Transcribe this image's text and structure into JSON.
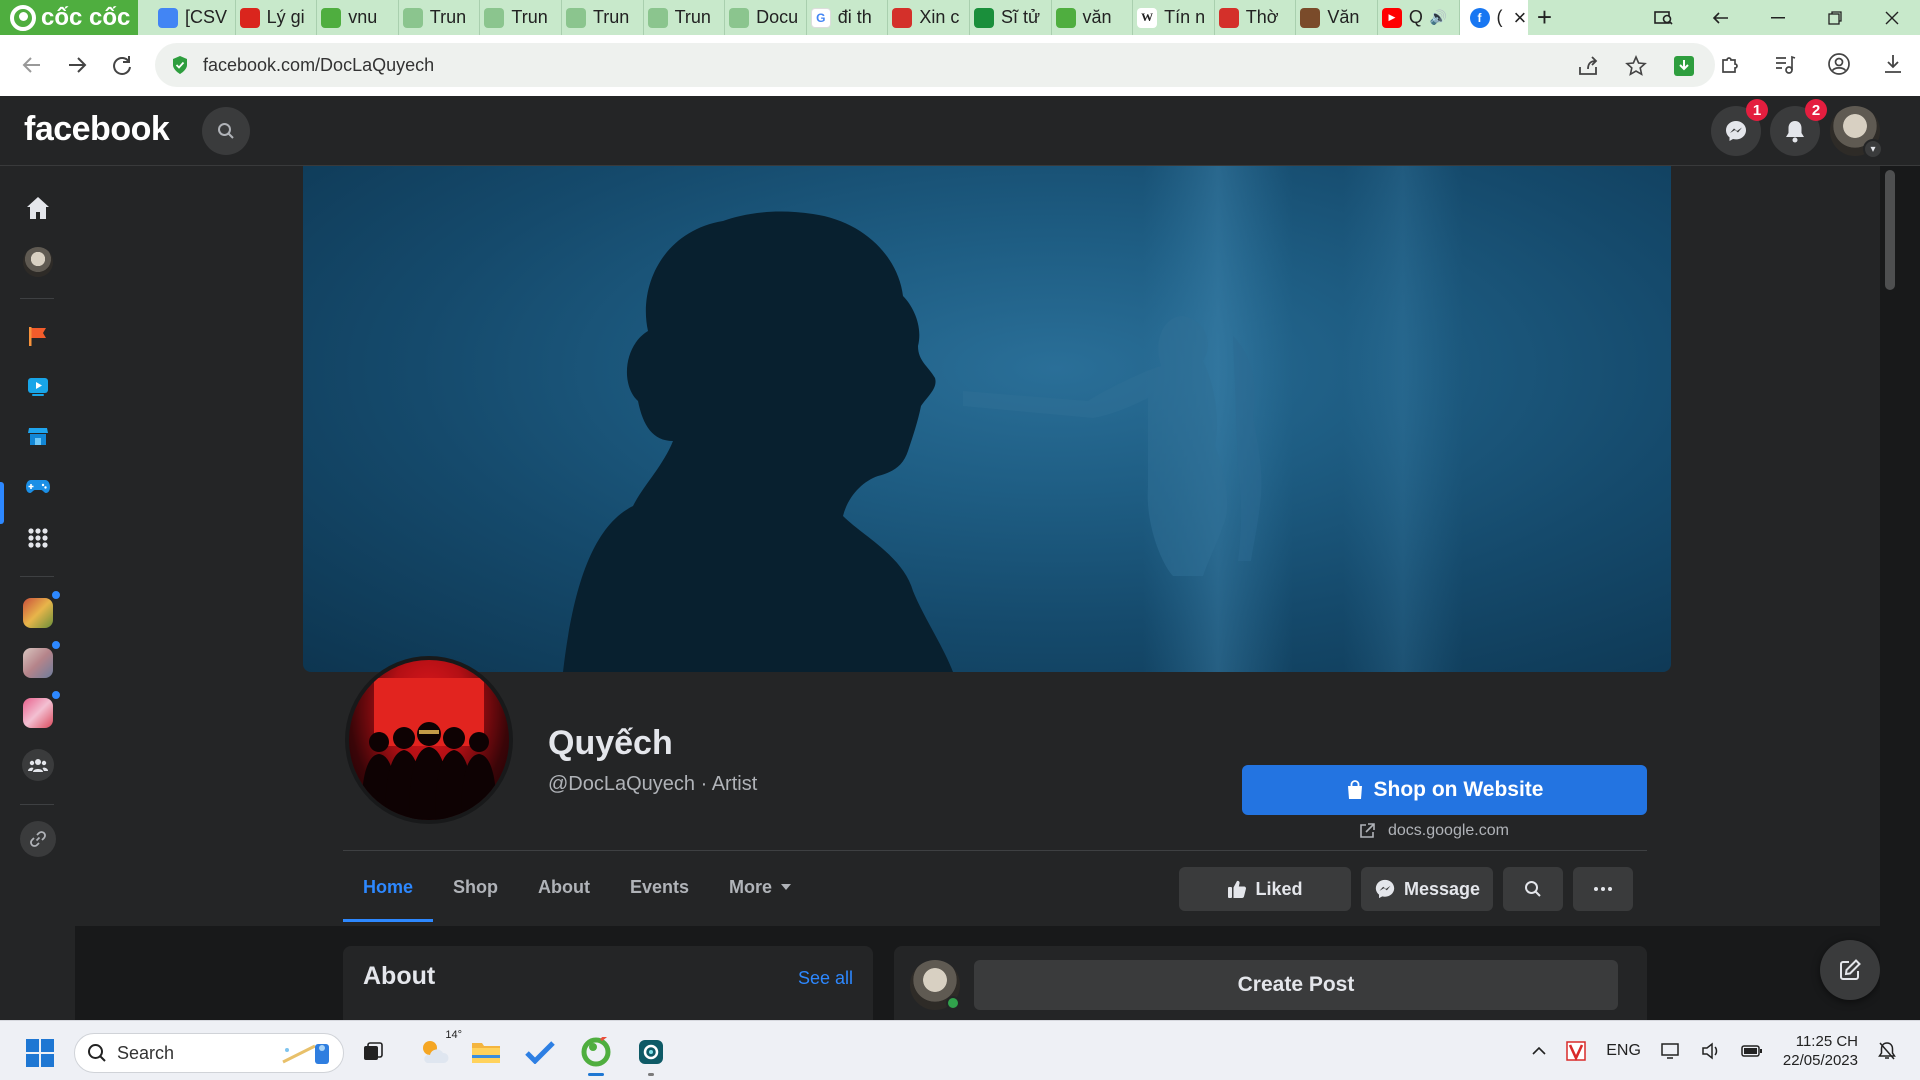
{
  "browser": {
    "brand_name": "cốc cốc",
    "tabs": [
      {
        "title": "[CSV",
        "icon": "google-docs-icon",
        "color": "#4285f4"
      },
      {
        "title": "Lý gi",
        "icon": "star-flag-icon",
        "color": "#da251d"
      },
      {
        "title": "vnu",
        "icon": "coccoc-icon",
        "color": "#4fae3f"
      },
      {
        "title": "Trun",
        "icon": "globe-icon",
        "color": "#8bc58e"
      },
      {
        "title": "Trun",
        "icon": "globe-icon",
        "color": "#8bc58e"
      },
      {
        "title": "Trun",
        "icon": "globe-icon",
        "color": "#8bc58e"
      },
      {
        "title": "Trun",
        "icon": "globe-icon",
        "color": "#8bc58e"
      },
      {
        "title": "Docu",
        "icon": "globe-icon",
        "color": "#8bc58e"
      },
      {
        "title": "đi th",
        "icon": "google-icon",
        "color": "#ffffff"
      },
      {
        "title": "Xin c",
        "icon": "emblem-icon",
        "color": "#d4302a"
      },
      {
        "title": "Sĩ tử",
        "icon": "news-icon",
        "color": "#1a8f3b"
      },
      {
        "title": "văn",
        "icon": "coccoc-icon",
        "color": "#4fae3f"
      },
      {
        "title": "Tín n",
        "icon": "wikipedia-icon",
        "color": "#ffffff"
      },
      {
        "title": "Thờ",
        "icon": "emblem-icon",
        "color": "#d4302a"
      },
      {
        "title": "Văn",
        "icon": "figure-icon",
        "color": "#7a4b2a"
      },
      {
        "title": "Q",
        "icon": "youtube-icon",
        "color": "#ff0000"
      }
    ],
    "active_tab": {
      "title": "(",
      "icon": "facebook-icon",
      "color": "#1877f2"
    },
    "url": "facebook.com/DocLaQuyech"
  },
  "facebook": {
    "logo": "facebook",
    "messenger_badge": "1",
    "notifications_badge": "2",
    "page": {
      "name": "Quyếch",
      "handle_line": "@DocLaQuyech · Artist",
      "primary_button": "Shop on Website",
      "website": "docs.google.com",
      "tabs": [
        {
          "label": "Home",
          "active": true
        },
        {
          "label": "Shop",
          "active": false
        },
        {
          "label": "About",
          "active": false
        },
        {
          "label": "Events",
          "active": false
        },
        {
          "label": "More",
          "active": false
        }
      ],
      "liked_button": "Liked",
      "message_button": "Message"
    },
    "about": {
      "title": "About",
      "see_all": "See all"
    },
    "create_post": "Create Post"
  },
  "taskbar": {
    "search_placeholder": "Search",
    "weather": "14°",
    "language": "ENG",
    "time": "11:25 CH",
    "date": "22/05/2023"
  },
  "colors": {
    "fb_blue": "#2374e1",
    "fb_dark": "#242526",
    "fb_bg": "#18191a",
    "coccoc_green": "#4fae3f"
  }
}
